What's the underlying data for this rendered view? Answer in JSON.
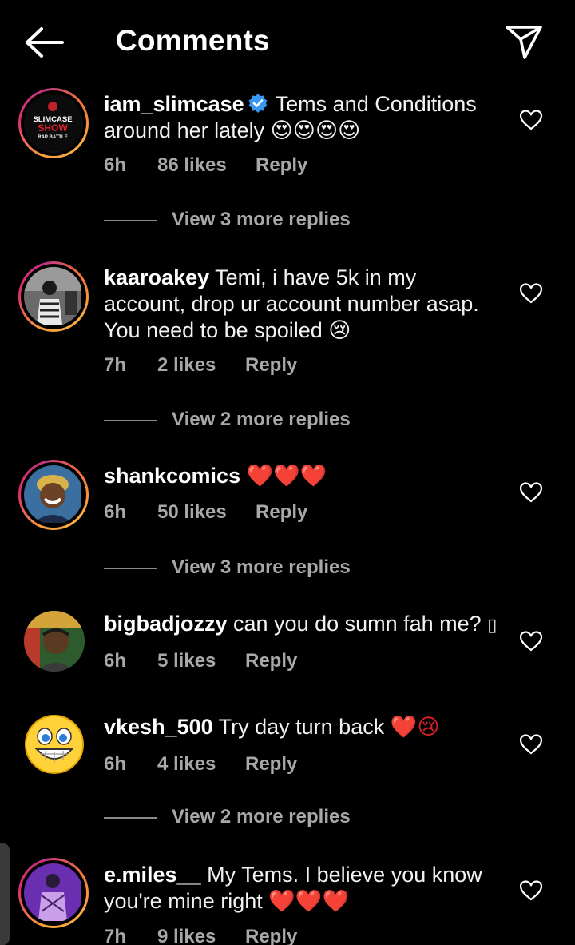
{
  "header": {
    "title": "Comments",
    "back_icon": "arrow-left-icon",
    "send_icon": "paper-plane-icon"
  },
  "comments": [
    {
      "username": "iam_slimcase",
      "verified": true,
      "text_line1": "Tems and Conditions",
      "text_line2": "around her lately",
      "emojis": "😍😍😍😍",
      "avatar_text": "SLIMCASE SHOW",
      "avatar_sub": "RAP BATTLE",
      "time": "6h",
      "likes": "86 likes",
      "reply": "Reply",
      "view_more": "View 3 more replies"
    },
    {
      "username": "kaaroakey",
      "text_line1": "Temi, i have 5k in my",
      "text_line2": "account, drop ur account number asap.",
      "text_line3": "You need to be spoiled",
      "emojis": "😢",
      "time": "7h",
      "likes": "2 likes",
      "reply": "Reply",
      "view_more": "View 2 more replies"
    },
    {
      "username": "shankcomics",
      "emojis": "❤️❤️❤️",
      "time": "6h",
      "likes": "50 likes",
      "reply": "Reply",
      "view_more": "View 3 more replies"
    },
    {
      "username": "bigbadjozzy",
      "text_line1": "can you do sumn fah me?",
      "emojis": "▯",
      "time": "6h",
      "likes": "5 likes",
      "reply": "Reply"
    },
    {
      "username": "vkesh_500",
      "text_line1": "Try day turn back",
      "emojis": "❤️😢",
      "time": "6h",
      "likes": "4 likes",
      "reply": "Reply",
      "view_more": "View 2 more replies"
    },
    {
      "username": "e.miles__",
      "text_line1": "My Tems. I believe you know",
      "text_line2": "you're mine right",
      "emojis": "❤️❤️❤️",
      "time": "7h",
      "likes": "9 likes",
      "reply": "Reply"
    }
  ],
  "colors": {
    "background": "#000000",
    "meta_text": "#a8a8a8",
    "verified": "#3897f0",
    "heart_emoji": "#e0202a"
  }
}
